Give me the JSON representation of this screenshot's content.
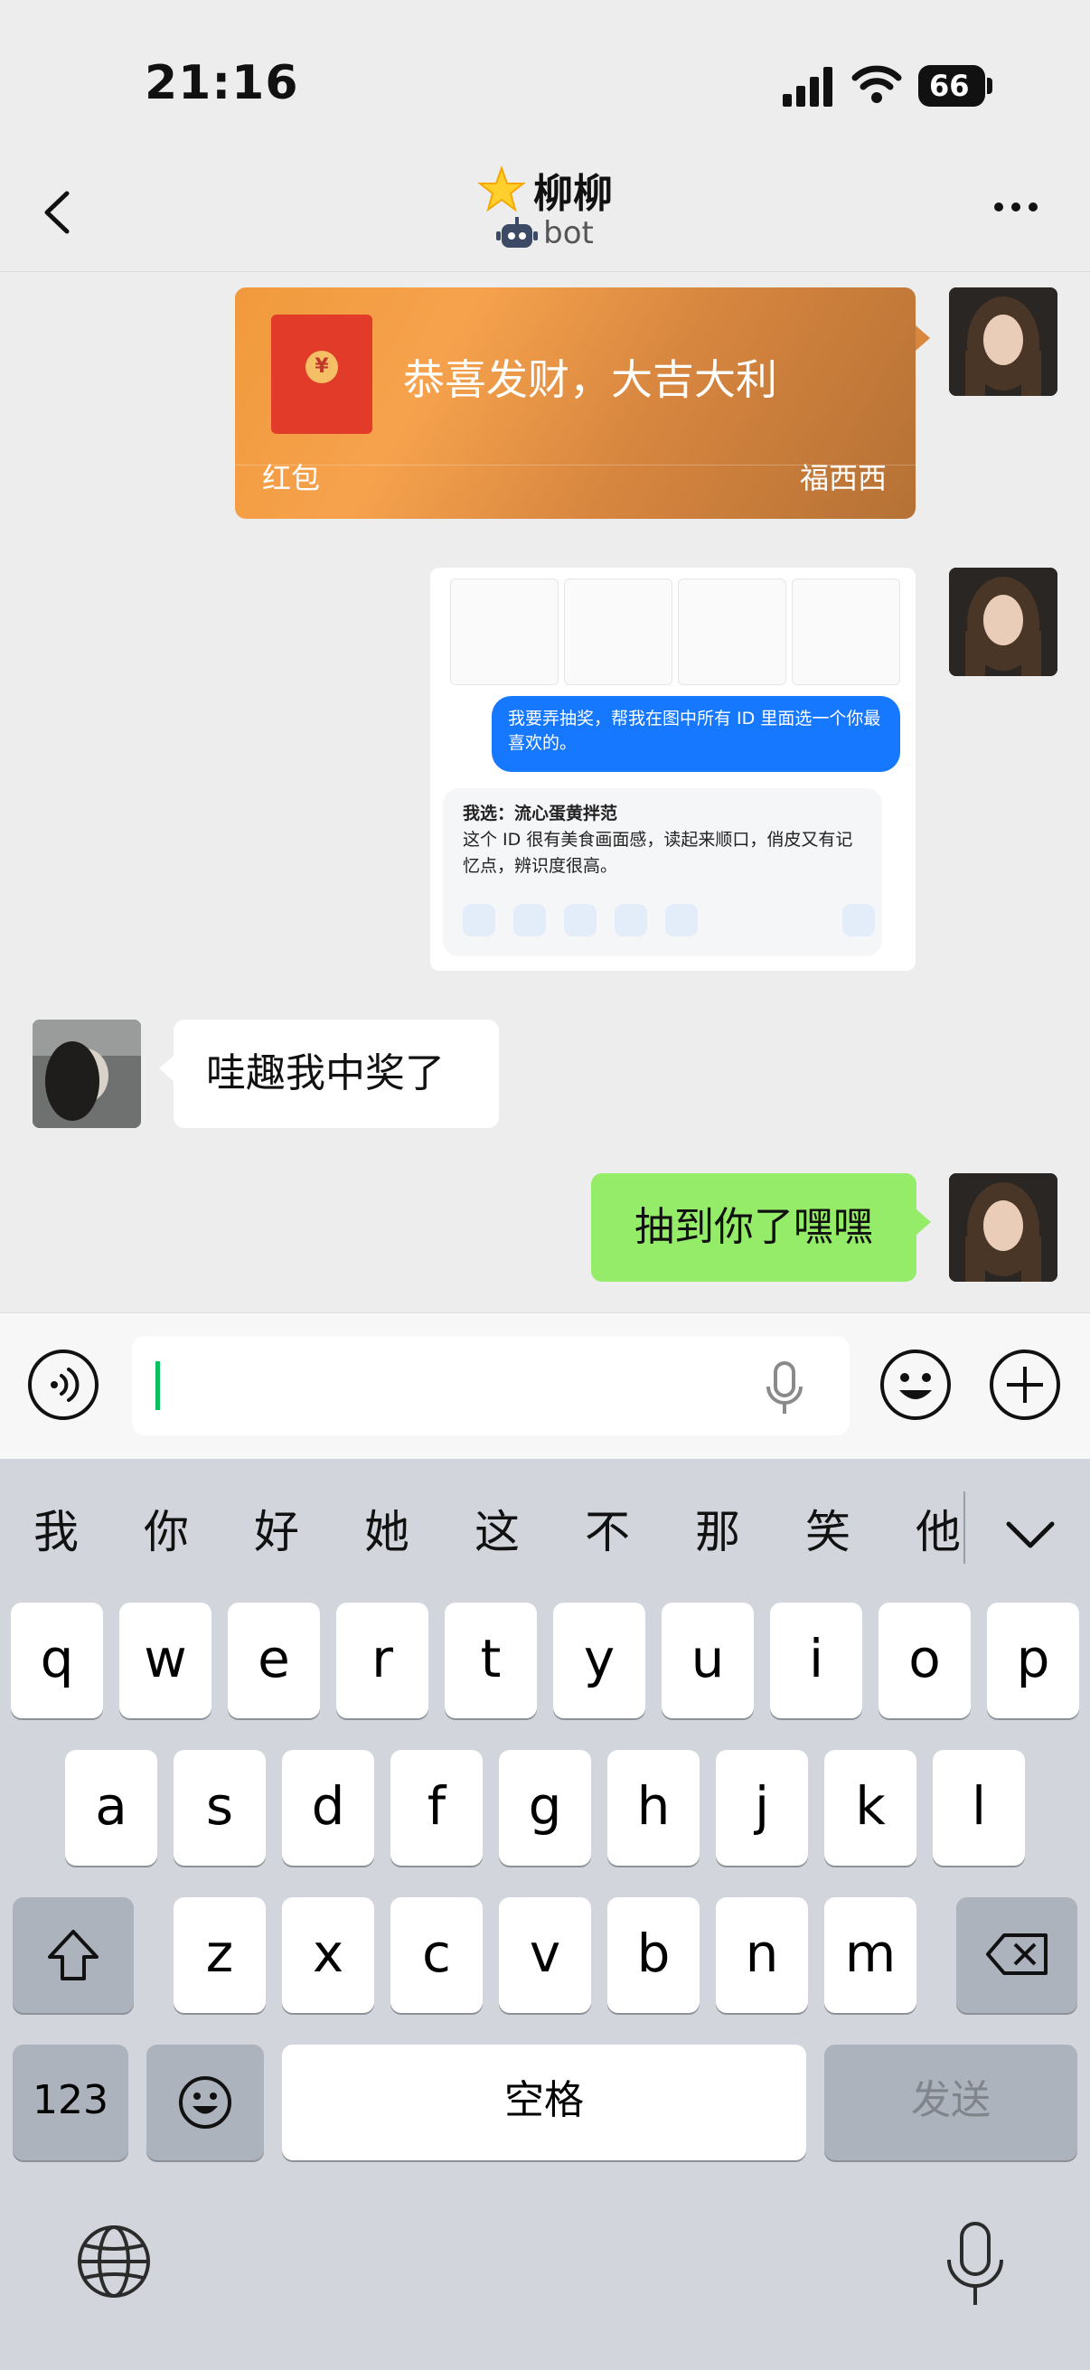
{
  "status_bar": {
    "time": "21:16",
    "battery": "66"
  },
  "nav": {
    "title": "柳柳",
    "subtitle": "bot"
  },
  "messages": {
    "red_packet": {
      "text": "恭喜发财，大吉大利",
      "label": "红包",
      "sender": "福西西",
      "coin": "¥"
    },
    "image_card": {
      "prompt": "我要弄抽奖，帮我在图中所有 ID 里面选一个你最喜欢的。",
      "answer_title": "我选：流心蛋黄拌范",
      "answer_body": "这个 ID 很有美食画面感，读起来顺口，俏皮又有记忆点，辨识度很高。"
    },
    "incoming": "哇趣我中奖了",
    "outgoing": "抽到你了嘿嘿"
  },
  "input": {
    "value": ""
  },
  "keyboard": {
    "candidates": [
      "我",
      "你",
      "好",
      "她",
      "这",
      "不",
      "那",
      "笑",
      "他"
    ],
    "row1": [
      "q",
      "w",
      "e",
      "r",
      "t",
      "y",
      "u",
      "i",
      "o",
      "p"
    ],
    "row2": [
      "a",
      "s",
      "d",
      "f",
      "g",
      "h",
      "j",
      "k",
      "l"
    ],
    "row3": [
      "z",
      "x",
      "c",
      "v",
      "b",
      "n",
      "m"
    ],
    "num_key": "123",
    "space_key": "空格",
    "send_key": "发送"
  },
  "colors": {
    "wechat_green": "#95ec69",
    "accent_green": "#07c160",
    "red_packet": "#f5a04a"
  }
}
